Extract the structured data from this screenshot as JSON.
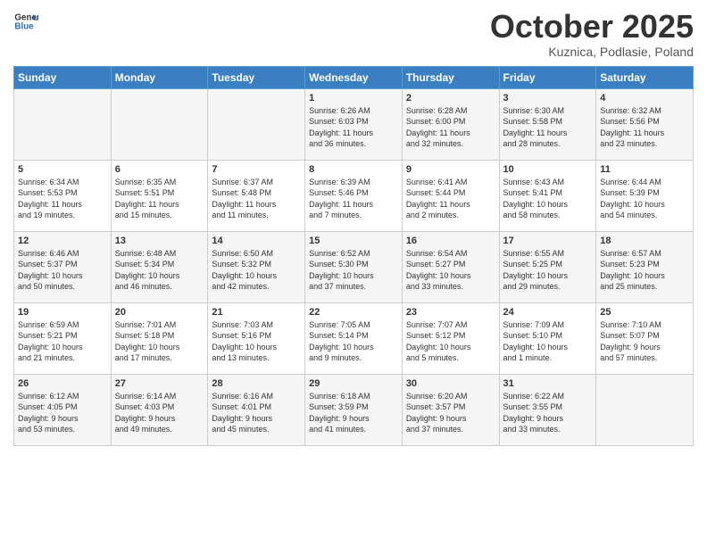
{
  "logo": {
    "general": "General",
    "blue": "Blue"
  },
  "header": {
    "month": "October 2025",
    "location": "Kuznica, Podlasie, Poland"
  },
  "weekdays": [
    "Sunday",
    "Monday",
    "Tuesday",
    "Wednesday",
    "Thursday",
    "Friday",
    "Saturday"
  ],
  "weeks": [
    [
      {
        "day": "",
        "text": ""
      },
      {
        "day": "",
        "text": ""
      },
      {
        "day": "",
        "text": ""
      },
      {
        "day": "1",
        "text": "Sunrise: 6:26 AM\nSunset: 6:03 PM\nDaylight: 11 hours\nand 36 minutes."
      },
      {
        "day": "2",
        "text": "Sunrise: 6:28 AM\nSunset: 6:00 PM\nDaylight: 11 hours\nand 32 minutes."
      },
      {
        "day": "3",
        "text": "Sunrise: 6:30 AM\nSunset: 5:58 PM\nDaylight: 11 hours\nand 28 minutes."
      },
      {
        "day": "4",
        "text": "Sunrise: 6:32 AM\nSunset: 5:56 PM\nDaylight: 11 hours\nand 23 minutes."
      }
    ],
    [
      {
        "day": "5",
        "text": "Sunrise: 6:34 AM\nSunset: 5:53 PM\nDaylight: 11 hours\nand 19 minutes."
      },
      {
        "day": "6",
        "text": "Sunrise: 6:35 AM\nSunset: 5:51 PM\nDaylight: 11 hours\nand 15 minutes."
      },
      {
        "day": "7",
        "text": "Sunrise: 6:37 AM\nSunset: 5:48 PM\nDaylight: 11 hours\nand 11 minutes."
      },
      {
        "day": "8",
        "text": "Sunrise: 6:39 AM\nSunset: 5:46 PM\nDaylight: 11 hours\nand 7 minutes."
      },
      {
        "day": "9",
        "text": "Sunrise: 6:41 AM\nSunset: 5:44 PM\nDaylight: 11 hours\nand 2 minutes."
      },
      {
        "day": "10",
        "text": "Sunrise: 6:43 AM\nSunset: 5:41 PM\nDaylight: 10 hours\nand 58 minutes."
      },
      {
        "day": "11",
        "text": "Sunrise: 6:44 AM\nSunset: 5:39 PM\nDaylight: 10 hours\nand 54 minutes."
      }
    ],
    [
      {
        "day": "12",
        "text": "Sunrise: 6:46 AM\nSunset: 5:37 PM\nDaylight: 10 hours\nand 50 minutes."
      },
      {
        "day": "13",
        "text": "Sunrise: 6:48 AM\nSunset: 5:34 PM\nDaylight: 10 hours\nand 46 minutes."
      },
      {
        "day": "14",
        "text": "Sunrise: 6:50 AM\nSunset: 5:32 PM\nDaylight: 10 hours\nand 42 minutes."
      },
      {
        "day": "15",
        "text": "Sunrise: 6:52 AM\nSunset: 5:30 PM\nDaylight: 10 hours\nand 37 minutes."
      },
      {
        "day": "16",
        "text": "Sunrise: 6:54 AM\nSunset: 5:27 PM\nDaylight: 10 hours\nand 33 minutes."
      },
      {
        "day": "17",
        "text": "Sunrise: 6:55 AM\nSunset: 5:25 PM\nDaylight: 10 hours\nand 29 minutes."
      },
      {
        "day": "18",
        "text": "Sunrise: 6:57 AM\nSunset: 5:23 PM\nDaylight: 10 hours\nand 25 minutes."
      }
    ],
    [
      {
        "day": "19",
        "text": "Sunrise: 6:59 AM\nSunset: 5:21 PM\nDaylight: 10 hours\nand 21 minutes."
      },
      {
        "day": "20",
        "text": "Sunrise: 7:01 AM\nSunset: 5:18 PM\nDaylight: 10 hours\nand 17 minutes."
      },
      {
        "day": "21",
        "text": "Sunrise: 7:03 AM\nSunset: 5:16 PM\nDaylight: 10 hours\nand 13 minutes."
      },
      {
        "day": "22",
        "text": "Sunrise: 7:05 AM\nSunset: 5:14 PM\nDaylight: 10 hours\nand 9 minutes."
      },
      {
        "day": "23",
        "text": "Sunrise: 7:07 AM\nSunset: 5:12 PM\nDaylight: 10 hours\nand 5 minutes."
      },
      {
        "day": "24",
        "text": "Sunrise: 7:09 AM\nSunset: 5:10 PM\nDaylight: 10 hours\nand 1 minute."
      },
      {
        "day": "25",
        "text": "Sunrise: 7:10 AM\nSunset: 5:07 PM\nDaylight: 9 hours\nand 57 minutes."
      }
    ],
    [
      {
        "day": "26",
        "text": "Sunrise: 6:12 AM\nSunset: 4:05 PM\nDaylight: 9 hours\nand 53 minutes."
      },
      {
        "day": "27",
        "text": "Sunrise: 6:14 AM\nSunset: 4:03 PM\nDaylight: 9 hours\nand 49 minutes."
      },
      {
        "day": "28",
        "text": "Sunrise: 6:16 AM\nSunset: 4:01 PM\nDaylight: 9 hours\nand 45 minutes."
      },
      {
        "day": "29",
        "text": "Sunrise: 6:18 AM\nSunset: 3:59 PM\nDaylight: 9 hours\nand 41 minutes."
      },
      {
        "day": "30",
        "text": "Sunrise: 6:20 AM\nSunset: 3:57 PM\nDaylight: 9 hours\nand 37 minutes."
      },
      {
        "day": "31",
        "text": "Sunrise: 6:22 AM\nSunset: 3:55 PM\nDaylight: 9 hours\nand 33 minutes."
      },
      {
        "day": "",
        "text": ""
      }
    ]
  ]
}
